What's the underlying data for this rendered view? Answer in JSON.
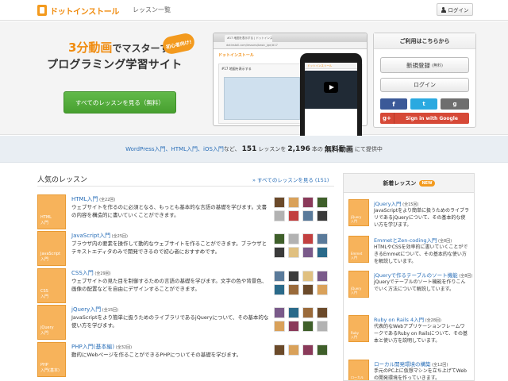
{
  "header": {
    "logo_text": "ドットインストール",
    "nav_lessons": "レッスン一覧",
    "login_label": "ログイン"
  },
  "hero": {
    "line1_accent": "3分動画",
    "line1_rest": "でマスターする",
    "line2": "プログラミング学習サイト",
    "badge": "初心者向け!",
    "cta_label": "すべてのレッスンを見る（無料）",
    "mock_tab": "#17 地図を表示する | ドットインストール",
    "mock_url": "dotinstall.com/lessons/basic_jqe/#17",
    "mock_logo": "ドットインストール",
    "mock_title": "#17 地図を表示する"
  },
  "signup": {
    "title": "ご利用はこちらから",
    "register_label": "新規登録",
    "register_note": "(無料)",
    "login_label": "ログイン",
    "facebook": "f",
    "twitter": "t",
    "github": "g",
    "google_g": "g+",
    "google_label": "Sign in with Google"
  },
  "stats": {
    "links": "WordPress入門、HTML入門、iOS入門",
    "mid1": "など、",
    "count": "151",
    "mid2": "レッスンを",
    "videos": "2,196",
    "mid3": "本の",
    "free": "無料動画",
    "end": "にて提供中"
  },
  "popular": {
    "title": "人気のレッスン",
    "all_link": "» すべてのレッスンを見る (151)",
    "lessons": [
      {
        "thumb": "HTML\n入門",
        "name": "HTML入門",
        "count": "(全22回)",
        "desc": "ウェブサイトを作るのに必須となる、もっとも基本的な言語の基礎を学びます。文書の内容を構造的に書いていくことができます。"
      },
      {
        "thumb": "JavaScript\n入門",
        "name": "JavaScript入門",
        "count": "(全25回)",
        "desc": "ブラウザ内の要素を操作して動的なウェブサイトを作ることができます。ブラウザとテキストエディタのみで開発できるので初心者におすすめです。"
      },
      {
        "thumb": "CSS\n入門",
        "name": "CSS入門",
        "count": "(全29回)",
        "desc": "ウェブサイトの見た目を制御するための言語の基礎を学びます。文字の色や背景色、画像の配置などを自由にデザインすることができます。"
      },
      {
        "thumb": "jQuery\n入門",
        "name": "jQuery入門",
        "count": "(全15回)",
        "desc": "JavaScriptをより簡単に扱うためのライブラリであるjQueryについて、その基本的な使い方を学びます。"
      },
      {
        "thumb": "PHP\n入門(基本)",
        "name": "PHP入門(基本編)",
        "count": "(全32回)",
        "desc": "動的にWebページを作ることができるPHPについてその基礎を学びます。"
      }
    ]
  },
  "new_lessons": {
    "title": "新着レッスン",
    "badge": "NEW",
    "items": [
      {
        "thumb": "jQuery\n入門",
        "name": "jQuery入門",
        "count": "(全15回)",
        "desc": "JavaScriptをより簡単に扱うためのライブラリであるjQueryについて、その基本的な使い方を学びます。"
      },
      {
        "thumb": "Emmet\n入門",
        "name": "EmmetとZen-coding入門",
        "count": "(全8回)",
        "desc": "HTMLやCSSを効率的に書いていくことができるEmmetについて、その基本的な使い方を解説しています。"
      },
      {
        "thumb": "jQuery\n入門",
        "name": "jQueryで作るテーブルのソート機能",
        "count": "(全8回)",
        "desc": "jQueryでテーブルのソート機能を作りこんでいく方法について解説しています。"
      },
      {
        "thumb": "Ruby\n入門",
        "name": "Ruby on Rails 4入門",
        "count": "(全28回)",
        "desc": "代表的なWebアプリケーションフレームワークであるRuby on Railsについて、その基本と使い方を説明しています。"
      },
      {
        "thumb": "ローカル\n入門",
        "name": "ローカル開発環境の構築",
        "count": "(全12回)",
        "desc": "手元のPC上に仮想マシンを立ち上げてWebの開発環境を作っていきます。"
      }
    ]
  },
  "avatar_colors": [
    "#6b4a2a",
    "#d9a15a",
    "#8a3a5a",
    "#3f5f2a",
    "#b2b2b2",
    "#c24040",
    "#5a7a9a",
    "#3a3a3a",
    "#e0c080",
    "#7a5a8a",
    "#2a6a8a",
    "#9a6a3a"
  ]
}
